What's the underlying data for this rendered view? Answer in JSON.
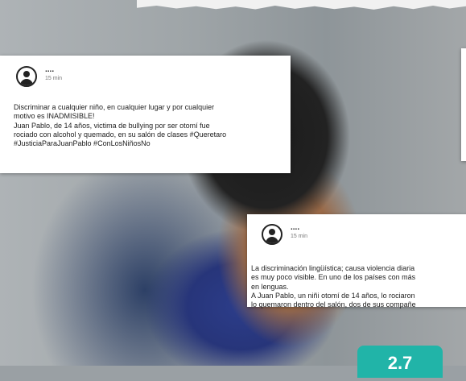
{
  "posts": [
    {
      "user": "....",
      "time": "15 min",
      "lines": [
        "Discriminar a cualquier niño, en cualquier lugar y por cualquier",
        "motivo es INADMISIBLE!",
        "Juan Pablo, de 14 años, victima de bullying por ser otomí fue",
        "rociado con alcohol y quemado, en su salón de clases #Queretaro",
        "#JusticiaParaJuanPablo #ConLosNiñosNo"
      ]
    },
    {
      "user": "....",
      "time": "15 min",
      "lines": [
        "La discriminación lingüística; causa violencia diaria",
        "es muy poco visible. En uno de los países con más",
        "en lenguas.",
        "A Juan Pablo, un niñi otomí de 14 años, lo rociaron",
        "lo quemaron dentro del salón, dos de sus compañe"
      ]
    }
  ],
  "badge": {
    "label": "2.7"
  },
  "colors": {
    "badge": "#21b4a8",
    "card": "#ffffff"
  },
  "icons": {
    "avatar": "user-avatar-icon"
  }
}
